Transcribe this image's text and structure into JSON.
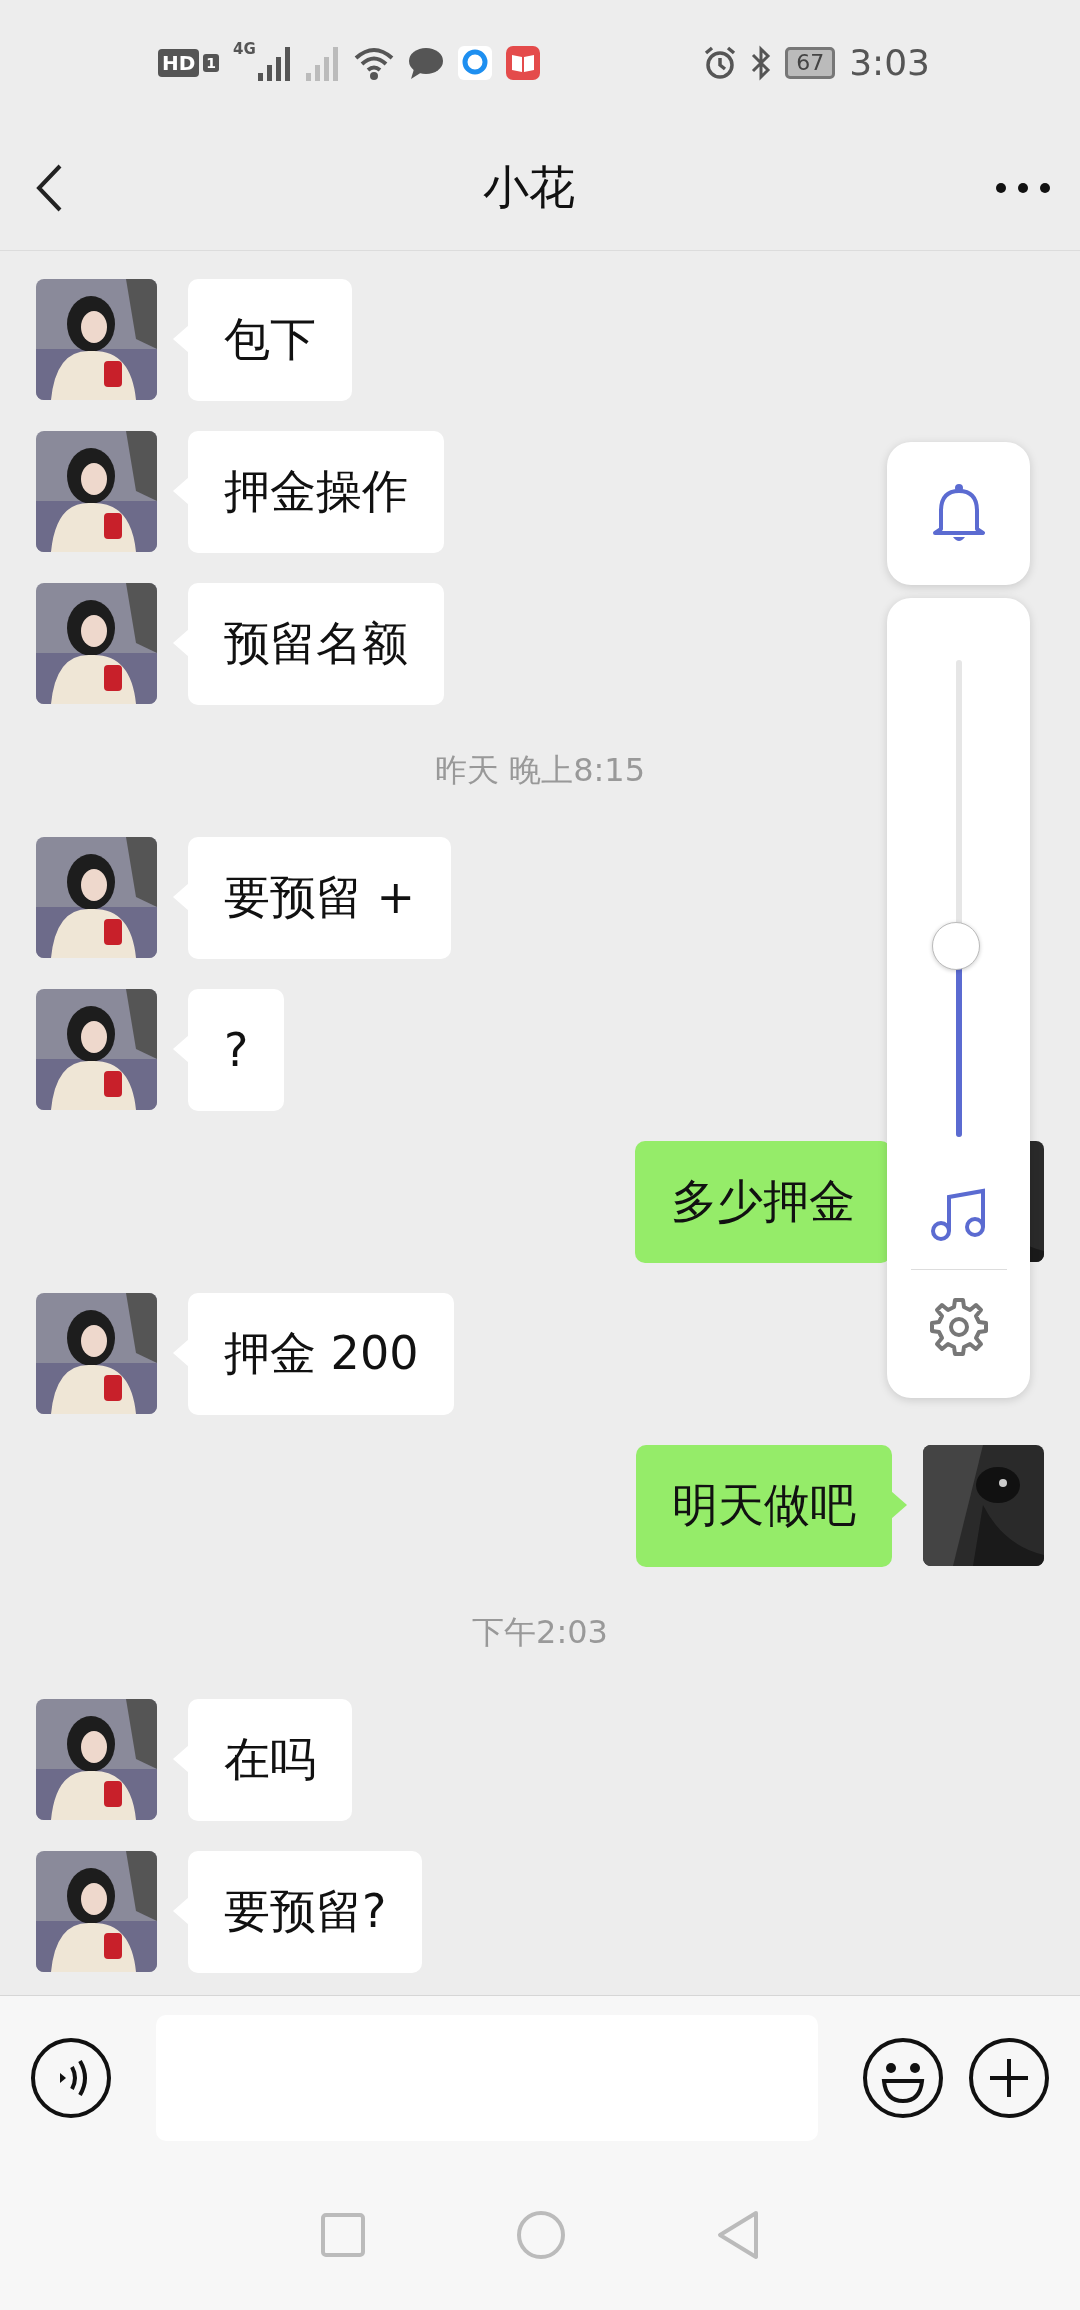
{
  "status_bar": {
    "hd": "HD",
    "sim": "1",
    "network": "4G",
    "battery": "67",
    "time": "3:03"
  },
  "header": {
    "title": "小花"
  },
  "messages": [
    {
      "kind": "incoming",
      "text": "包下"
    },
    {
      "kind": "incoming",
      "text": "押金操作"
    },
    {
      "kind": "incoming",
      "text": "预留名额"
    },
    {
      "kind": "time",
      "text": "昨天 晚上8:15"
    },
    {
      "kind": "incoming",
      "text": "要预留 +"
    },
    {
      "kind": "incoming",
      "text": "?"
    },
    {
      "kind": "outgoing",
      "text": "多少押金",
      "tail_visible": false
    },
    {
      "kind": "incoming",
      "text": "押金 200"
    },
    {
      "kind": "outgoing",
      "text": "明天做吧"
    },
    {
      "kind": "time",
      "text": "下午2:03"
    },
    {
      "kind": "incoming",
      "text": "在吗"
    },
    {
      "kind": "incoming",
      "text": "要预留?"
    }
  ],
  "volume_panel": {
    "level": 0.4
  }
}
